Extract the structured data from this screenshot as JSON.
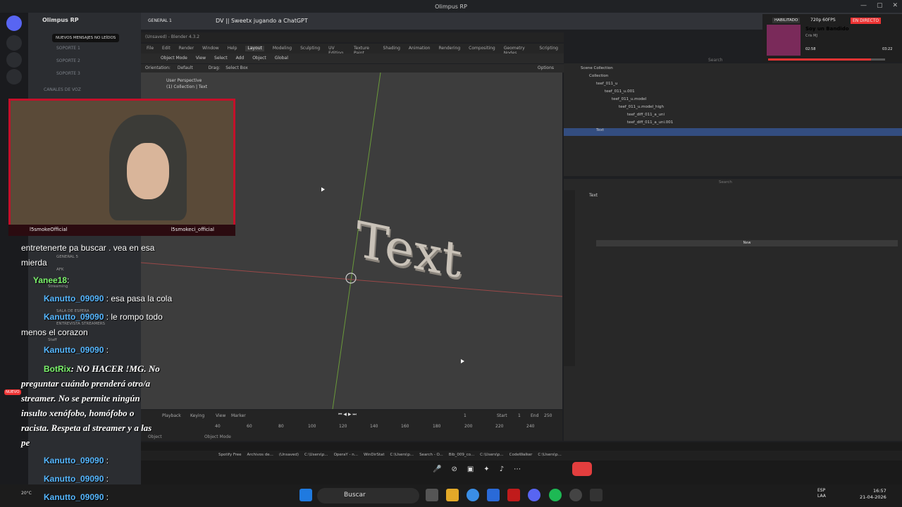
{
  "window": {
    "title": "Olimpus RP"
  },
  "discord": {
    "server_name": "Olimpus RP",
    "tooltip": "NUEVOS MENSAJES NO LEÍDOS",
    "channels": [
      "SOPORTE 1",
      "SOPORTE 2",
      "SOPORTE 3"
    ],
    "voice_category": "CANALES DE VOZ",
    "voice_header": "GENERAL 1",
    "stream_title": "DV || Sweetx jugando a ChatGPT",
    "mini_labels": [
      "GENERAL 5",
      "AFK",
      "Streaming",
      "SALA DE ESPERA",
      "ENTREVISTA STREAMERS",
      "Staff",
      "NUEVO"
    ],
    "tabs": [
      "Spotify Free",
      "Archivos de...",
      "(Unsaved)",
      "C:\\Users\\p...",
      "OperaY - n...",
      "WinDirStat",
      "C:\\Users\\p...",
      "Search - O...",
      "Bib_009_co...",
      "C:\\Users\\p...",
      "CodeWalker",
      "C:\\Users\\p..."
    ]
  },
  "blender": {
    "unsaved": "(Unsaved) - Blender 4.3.2",
    "menu": [
      "File",
      "Edit",
      "Render",
      "Window",
      "Help",
      "Layout",
      "Modeling",
      "Sculpting",
      "UV Editing",
      "Texture Paint",
      "Shading",
      "Animation",
      "Rendering",
      "Compositing",
      "Geometry Nodes",
      "Scripting"
    ],
    "header": [
      "Object Mode",
      "View",
      "Select",
      "Add",
      "Object",
      "Global"
    ],
    "orientation": "Orientation:",
    "orientation_val": "Default",
    "drag": "Drag:",
    "drag_val": "Select Box",
    "options": "Options",
    "viewport_info": [
      "User Perspective",
      "(1) Collection | Text"
    ],
    "object_text": "Text",
    "timeline": {
      "items": [
        "Playback",
        "Keying",
        "View",
        "Marker"
      ],
      "frame": "1",
      "start_label": "Start",
      "start": "1",
      "end_label": "End",
      "end": "250",
      "ticks": [
        "40",
        "60",
        "80",
        "100",
        "120",
        "140",
        "160",
        "180",
        "200",
        "220",
        "240"
      ]
    },
    "outliner": [
      "Scene Collection",
      "Collection",
      "teef_011_u",
      "teef_011_u.001",
      "teef_011_u.model",
      "teef_011_u.model_high",
      "teef_diff_011_a_uni",
      "teef_diff_011_a_uni.001",
      "Text"
    ],
    "search": "Search",
    "props_title": "Text",
    "new_btn": "New",
    "bottom_tabs": [
      "Object",
      "Object Mode"
    ]
  },
  "media": {
    "song": "Soy un Bandido",
    "artist": "Cris MJ",
    "time_elapsed": "02:58",
    "time_total": "03:22",
    "badge_fps": "720p 60FPS",
    "badge_live": "EN DIRECTO",
    "badge_user": "HABILITADO"
  },
  "webcam": {
    "handle_left": "l5smokeOfficial",
    "handle_right": "l5smokeci_official"
  },
  "chat": [
    {
      "nick": "",
      "text": "entretenerte pa buscar . vea en esa"
    },
    {
      "nick": "",
      "text": "mierda"
    },
    {
      "nick": "Yanee18",
      "text": ": "
    },
    {
      "nick": "Kanutto_09090",
      "text": ": esa pasa la cola"
    },
    {
      "nick": "Kanutto_09090",
      "text": ": le rompo todo"
    },
    {
      "nick": "",
      "text": "menos el corazon"
    },
    {
      "nick": "Kanutto_09090",
      "text": ": "
    },
    {
      "nick": "BotRix",
      "text": ": NO HACER !MG. No"
    },
    {
      "nick": "",
      "text": "preguntar cuándo prenderá otro/a"
    },
    {
      "nick": "",
      "text": "streamer. No se permite ningún"
    },
    {
      "nick": "",
      "text": "insulto xenófobo, homófobo o"
    },
    {
      "nick": "",
      "text": "racista. Respeta al streamer y a las"
    },
    {
      "nick": "",
      "text": "pe"
    },
    {
      "nick": "Kanutto_09090",
      "text": ": "
    },
    {
      "nick": "Kanutto_09090",
      "text": ": "
    },
    {
      "nick": "Kanutto_09090",
      "text": ": "
    }
  ],
  "taskbar": {
    "search": "Buscar",
    "lang1": "ESP",
    "lang2": "LAA",
    "time": "16:57",
    "date": "21-04-2026",
    "weather": "20°C"
  }
}
